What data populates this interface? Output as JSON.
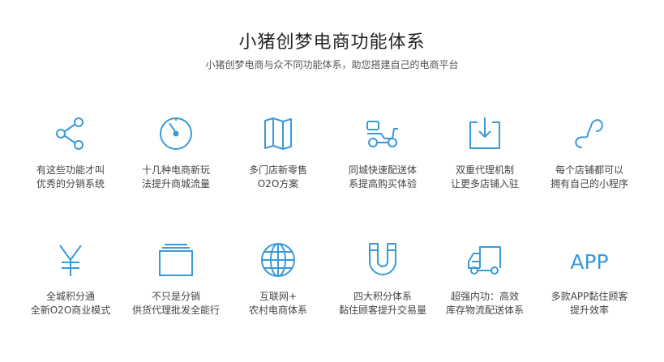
{
  "header": {
    "title": "小猪创梦电商功能体系",
    "subtitle": "小猪创梦电商与众不同功能体系，助您搭建自己的电商平台"
  },
  "theme": {
    "accent": "#3a9ad9"
  },
  "features": [
    {
      "icon": "share-icon",
      "line1": "有这些功能才叫",
      "line2": "优秀的分销系统"
    },
    {
      "icon": "stopwatch-icon",
      "line1": "十几种电商新玩",
      "line2": "法提升商城流量"
    },
    {
      "icon": "map-icon",
      "line1": "多门店新零售",
      "line2": "O2O方案"
    },
    {
      "icon": "delivery-scooter-icon",
      "line1": "同城快速配送体",
      "line2": "系提高购买体验"
    },
    {
      "icon": "download-box-icon",
      "line1": "双重代理机制",
      "line2": "让更多店铺入驻"
    },
    {
      "icon": "mini-program-icon",
      "line1": "每个店铺都可以",
      "line2": "拥有自己的小程序"
    },
    {
      "icon": "yen-icon",
      "line1": "全城积分通",
      "line2": "全新O2O商业模式"
    },
    {
      "icon": "stacked-folder-icon",
      "line1": "不只是分销",
      "line2": "供货代理批发全能行"
    },
    {
      "icon": "globe-icon",
      "line1": "互联网+",
      "line2": "农村电商体系"
    },
    {
      "icon": "magnet-icon",
      "line1": "四大积分体系",
      "line2": "黏住顾客提升交易量"
    },
    {
      "icon": "truck-icon",
      "line1": "超强内功：高效",
      "line2": "库存物流配送体系"
    },
    {
      "icon": "app-text-icon",
      "icon_text": "APP",
      "line1": "多款APP黏住顾客",
      "line2": "提升效率"
    }
  ]
}
